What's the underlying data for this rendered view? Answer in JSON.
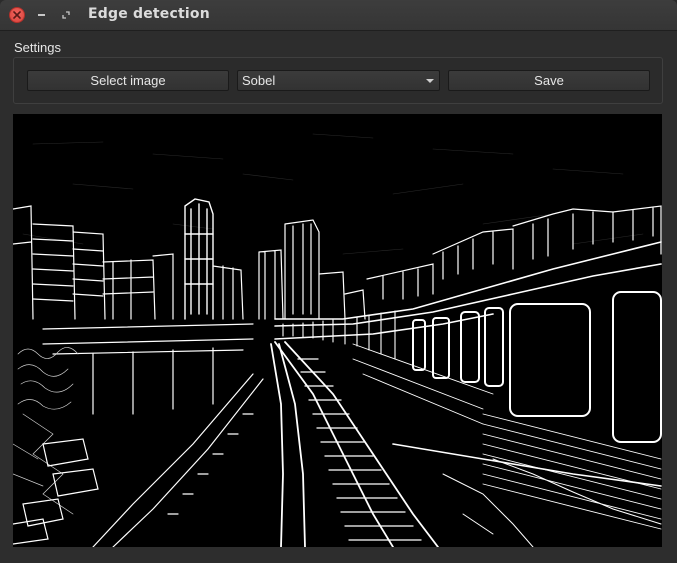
{
  "window": {
    "title": "Edge detection"
  },
  "settings": {
    "group_label": "Settings",
    "select_image_label": "Select image",
    "method_selected": "Sobel",
    "save_label": "Save"
  },
  "image": {
    "alt": "Sobel edge-detected image of an elevated train on tracks with city skyline",
    "icon": "edge-image"
  },
  "colors": {
    "close_button": "#e0463f",
    "window_bg": "#2d2d2d",
    "image_bg": "#000000",
    "edge_lines": "#ffffff"
  }
}
